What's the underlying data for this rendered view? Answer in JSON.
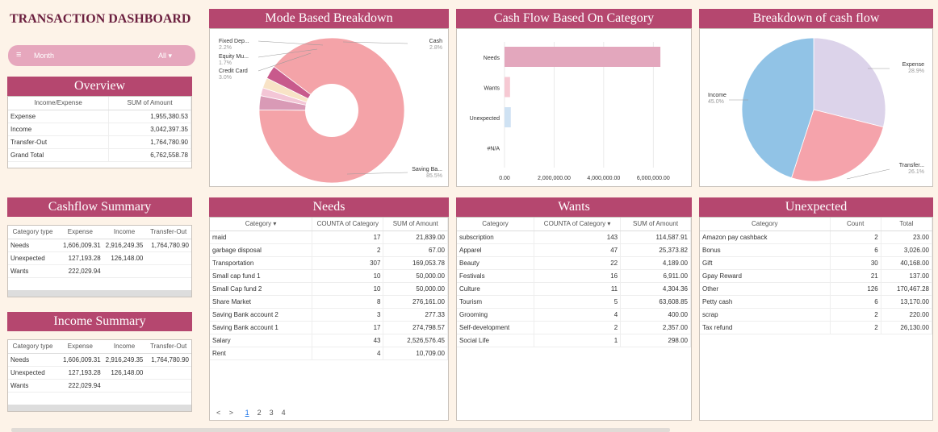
{
  "title": "TRANSACTION DASHBOARD",
  "filter": {
    "label": "Month",
    "value": "All"
  },
  "overview": {
    "title": "Overview",
    "headers": [
      "Income/Expense",
      "SUM of Amount"
    ],
    "rows": [
      [
        "Expense",
        "1,955,380.53"
      ],
      [
        "Income",
        "3,042,397.35"
      ],
      [
        "Transfer-Out",
        "1,764,780.90"
      ],
      [
        "Grand Total",
        "6,762,558.78"
      ]
    ]
  },
  "cashflow_summary": {
    "title": "Cashflow Summary",
    "headers": [
      "Category type",
      "Expense",
      "Income",
      "Transfer-Out"
    ],
    "rows": [
      [
        "Needs",
        "1,606,009.31",
        "2,916,249.35",
        "1,764,780.90"
      ],
      [
        "Unexpected",
        "127,193.28",
        "126,148.00",
        ""
      ],
      [
        "Wants",
        "222,029.94",
        "",
        ""
      ]
    ]
  },
  "income_summary": {
    "title": "Income Summary",
    "headers": [
      "Category type",
      "Expense",
      "Income",
      "Transfer-Out"
    ],
    "rows": [
      [
        "Needs",
        "1,606,009.31",
        "2,916,249.35",
        "1,764,780.90"
      ],
      [
        "Unexpected",
        "127,193.28",
        "126,148.00",
        ""
      ],
      [
        "Wants",
        "222,029.94",
        "",
        ""
      ]
    ]
  },
  "mode_chart": {
    "title": "Mode Based Breakdown",
    "labels": [
      {
        "name": "Fixed Dep...",
        "pct": "2.2%"
      },
      {
        "name": "Equity Mu...",
        "pct": "1.7%"
      },
      {
        "name": "Credit Card",
        "pct": "3.0%"
      },
      {
        "name": "Cash",
        "pct": "2.8%"
      },
      {
        "name": "Saving Ba...",
        "pct": "85.5%"
      }
    ]
  },
  "category_chart": {
    "title": "Cash Flow Based On Category",
    "x_ticks": [
      "0.00",
      "2,000,000.00",
      "4,000,000.00",
      "6,000,000.00"
    ]
  },
  "breakdown_chart": {
    "title": "Breakdown of cash flow",
    "labels": [
      {
        "name": "Expense",
        "pct": "28.9%"
      },
      {
        "name": "Income",
        "pct": "45.0%"
      },
      {
        "name": "Transfer...",
        "pct": "26.1%"
      }
    ]
  },
  "chart_data": [
    {
      "type": "pie",
      "title": "Mode Based Breakdown",
      "donut": true,
      "categories": [
        "Saving Ba...",
        "Credit Card",
        "Equity Mu...",
        "Fixed Dep...",
        "Cash"
      ],
      "values": [
        85.5,
        3.0,
        1.7,
        2.2,
        2.8
      ],
      "colors": [
        "#f4a3a8",
        "#d99ab6",
        "#f3c6d6",
        "#f8e3c6",
        "#c85a8c"
      ]
    },
    {
      "type": "bar",
      "title": "Cash Flow Based On Category",
      "orientation": "horizontal",
      "categories": [
        "Needs",
        "Wants",
        "Unexpected",
        "#N/A"
      ],
      "values": [
        6287039.56,
        222029.94,
        253341.28,
        0
      ],
      "colors": [
        "#e3a7bd",
        "#f6c9d3",
        "#cfe2f3",
        "#ffffff"
      ],
      "xlim": [
        0,
        7000000
      ]
    },
    {
      "type": "pie",
      "title": "Breakdown of cash flow",
      "categories": [
        "Expense",
        "Transfer...",
        "Income"
      ],
      "values": [
        28.9,
        26.1,
        45.0
      ],
      "colors": [
        "#dcd3ea",
        "#f5a3ab",
        "#91c3e6"
      ]
    }
  ],
  "needs": {
    "title": "Needs",
    "headers": [
      "Category",
      "COUNTA of Category",
      "SUM of Amount"
    ],
    "rows": [
      [
        "maid",
        "17",
        "21,839.00"
      ],
      [
        "garbage disposal",
        "2",
        "67.00"
      ],
      [
        "Transportation",
        "307",
        "169,053.78"
      ],
      [
        "Small cap fund 1",
        "10",
        "50,000.00"
      ],
      [
        "Small Cap fund 2",
        "10",
        "50,000.00"
      ],
      [
        "Share Market",
        "8",
        "276,161.00"
      ],
      [
        "Saving Bank account 2",
        "3",
        "277.33"
      ],
      [
        "Saving Bank account 1",
        "17",
        "274,798.57"
      ],
      [
        "Salary",
        "43",
        "2,526,576.45"
      ],
      [
        "Rent",
        "4",
        "10,709.00"
      ]
    ],
    "pages": [
      "1",
      "2",
      "3",
      "4"
    ]
  },
  "wants": {
    "title": "Wants",
    "headers": [
      "Category",
      "COUNTA of Category",
      "SUM of Amount"
    ],
    "rows": [
      [
        "subscription",
        "143",
        "114,587.91"
      ],
      [
        "Apparel",
        "47",
        "25,373.82"
      ],
      [
        "Beauty",
        "22",
        "4,189.00"
      ],
      [
        "Festivals",
        "16",
        "6,911.00"
      ],
      [
        "Culture",
        "11",
        "4,304.36"
      ],
      [
        "Tourism",
        "5",
        "63,608.85"
      ],
      [
        "Grooming",
        "4",
        "400.00"
      ],
      [
        "Self-development",
        "2",
        "2,357.00"
      ],
      [
        "Social Life",
        "1",
        "298.00"
      ]
    ]
  },
  "unexpected": {
    "title": "Unexpected",
    "headers": [
      "Category",
      "Count",
      "Total"
    ],
    "rows": [
      [
        "Amazon pay cashback",
        "2",
        "23.00"
      ],
      [
        "Bonus",
        "6",
        "3,026.00"
      ],
      [
        "Gift",
        "30",
        "40,168.00"
      ],
      [
        "Gpay Reward",
        "21",
        "137.00"
      ],
      [
        "Other",
        "126",
        "170,467.28"
      ],
      [
        "Petty cash",
        "6",
        "13,170.00"
      ],
      [
        "scrap",
        "2",
        "220.00"
      ],
      [
        "Tax refund",
        "2",
        "26,130.00"
      ]
    ]
  }
}
